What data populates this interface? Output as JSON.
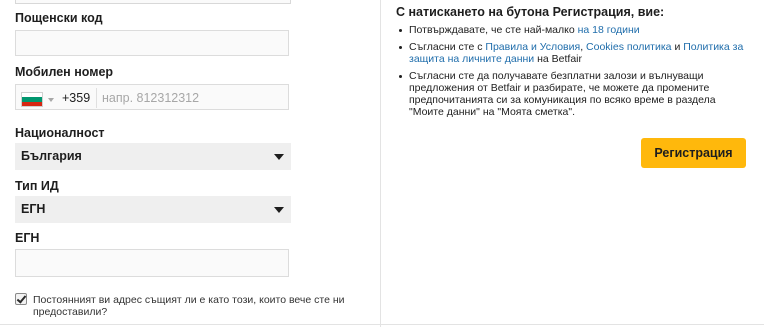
{
  "form": {
    "postal_code": {
      "label": "Пощенски код",
      "value": ""
    },
    "mobile": {
      "label": "Мобилен номер",
      "country_code": "+359",
      "placeholder": "напр. 812312312",
      "flag_icon": "bulgaria-flag-icon",
      "flag_colors": [
        "#ffffff",
        "#00966e",
        "#d62612"
      ]
    },
    "nationality": {
      "label": "Националност",
      "selected": "България"
    },
    "id_type": {
      "label": "Тип ИД",
      "selected": "ЕГН"
    },
    "id_number": {
      "label": "ЕГН",
      "value": ""
    },
    "same_address": {
      "checked": true,
      "label": "Постоянният ви адрес същият ли е като този, които вече сте ни предоставили?"
    }
  },
  "terms": {
    "title": "С натискането на бутона Регистрация, вие:",
    "items": [
      {
        "parts": [
          {
            "text": "Потвърждавате, че сте най-малко ",
            "link": false
          },
          {
            "text": "на 18 години",
            "link": true
          }
        ]
      },
      {
        "parts": [
          {
            "text": "Съгласни сте с ",
            "link": false
          },
          {
            "text": "Правила и Условия",
            "link": true
          },
          {
            "text": ", ",
            "link": false
          },
          {
            "text": "Cookies политика",
            "link": true
          },
          {
            "text": " и ",
            "link": false
          },
          {
            "text": "Политика за защита на личните данни",
            "link": true
          },
          {
            "text": " на Betfair",
            "link": false
          }
        ]
      },
      {
        "parts": [
          {
            "text": "Съгласни сте да получавате безплатни залози и вълнуващи предложения от Betfair и разбирате, че можете да промените предпочитанията си за комуникация по всяко време в раздела \"Моите данни\" на \"Моята сметка\".",
            "link": false
          }
        ]
      }
    ],
    "register_label": "Регистрация"
  },
  "colors": {
    "accent": "#ffb80c",
    "link": "#1f6dab"
  }
}
